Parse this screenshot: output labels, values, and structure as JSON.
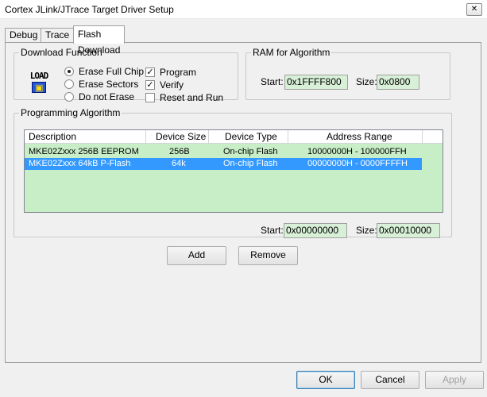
{
  "window": {
    "title": "Cortex JLink/JTrace Target Driver Setup",
    "close_glyph": "✕"
  },
  "tabs": [
    {
      "label": "Debug"
    },
    {
      "label": "Trace"
    },
    {
      "label": "Flash Download",
      "active": true
    }
  ],
  "download_function": {
    "legend": "Download Function",
    "icon_text": "LOAD",
    "icon_glyph": "▣",
    "radios": [
      {
        "label": "Erase Full Chip",
        "checked": true
      },
      {
        "label": "Erase Sectors",
        "checked": false
      },
      {
        "label": "Do not Erase",
        "checked": false
      }
    ],
    "checkboxes": [
      {
        "label": "Program",
        "checked": true
      },
      {
        "label": "Verify",
        "checked": true
      },
      {
        "label": "Reset and Run",
        "checked": false
      }
    ]
  },
  "ram": {
    "legend": "RAM for Algorithm",
    "start_label": "Start:",
    "start_value": "0x1FFFF800",
    "size_label": "Size:",
    "size_value": "0x0800"
  },
  "programming_algorithm": {
    "legend": "Programming Algorithm",
    "columns": [
      "Description",
      "Device Size",
      "Device Type",
      "Address Range"
    ],
    "rows": [
      {
        "description": "MKE02Zxxx 256B EEPROM",
        "size": "256B",
        "type": "On-chip Flash",
        "range": "10000000H - 100000FFH",
        "selected": false
      },
      {
        "description": "MKE02Zxxx 64kB P-Flash",
        "size": "64k",
        "type": "On-chip Flash",
        "range": "00000000H - 0000FFFFH",
        "selected": true
      }
    ],
    "start_label": "Start:",
    "start_value": "0x00000000",
    "size_label": "Size:",
    "size_value": "0x00010000"
  },
  "buttons": {
    "add": "Add",
    "remove": "Remove",
    "ok": "OK",
    "cancel": "Cancel",
    "apply": "Apply"
  },
  "colors": {
    "field_bg": "#d7f0d7",
    "list_bg": "#c8eec8",
    "selection": "#3399ff"
  }
}
